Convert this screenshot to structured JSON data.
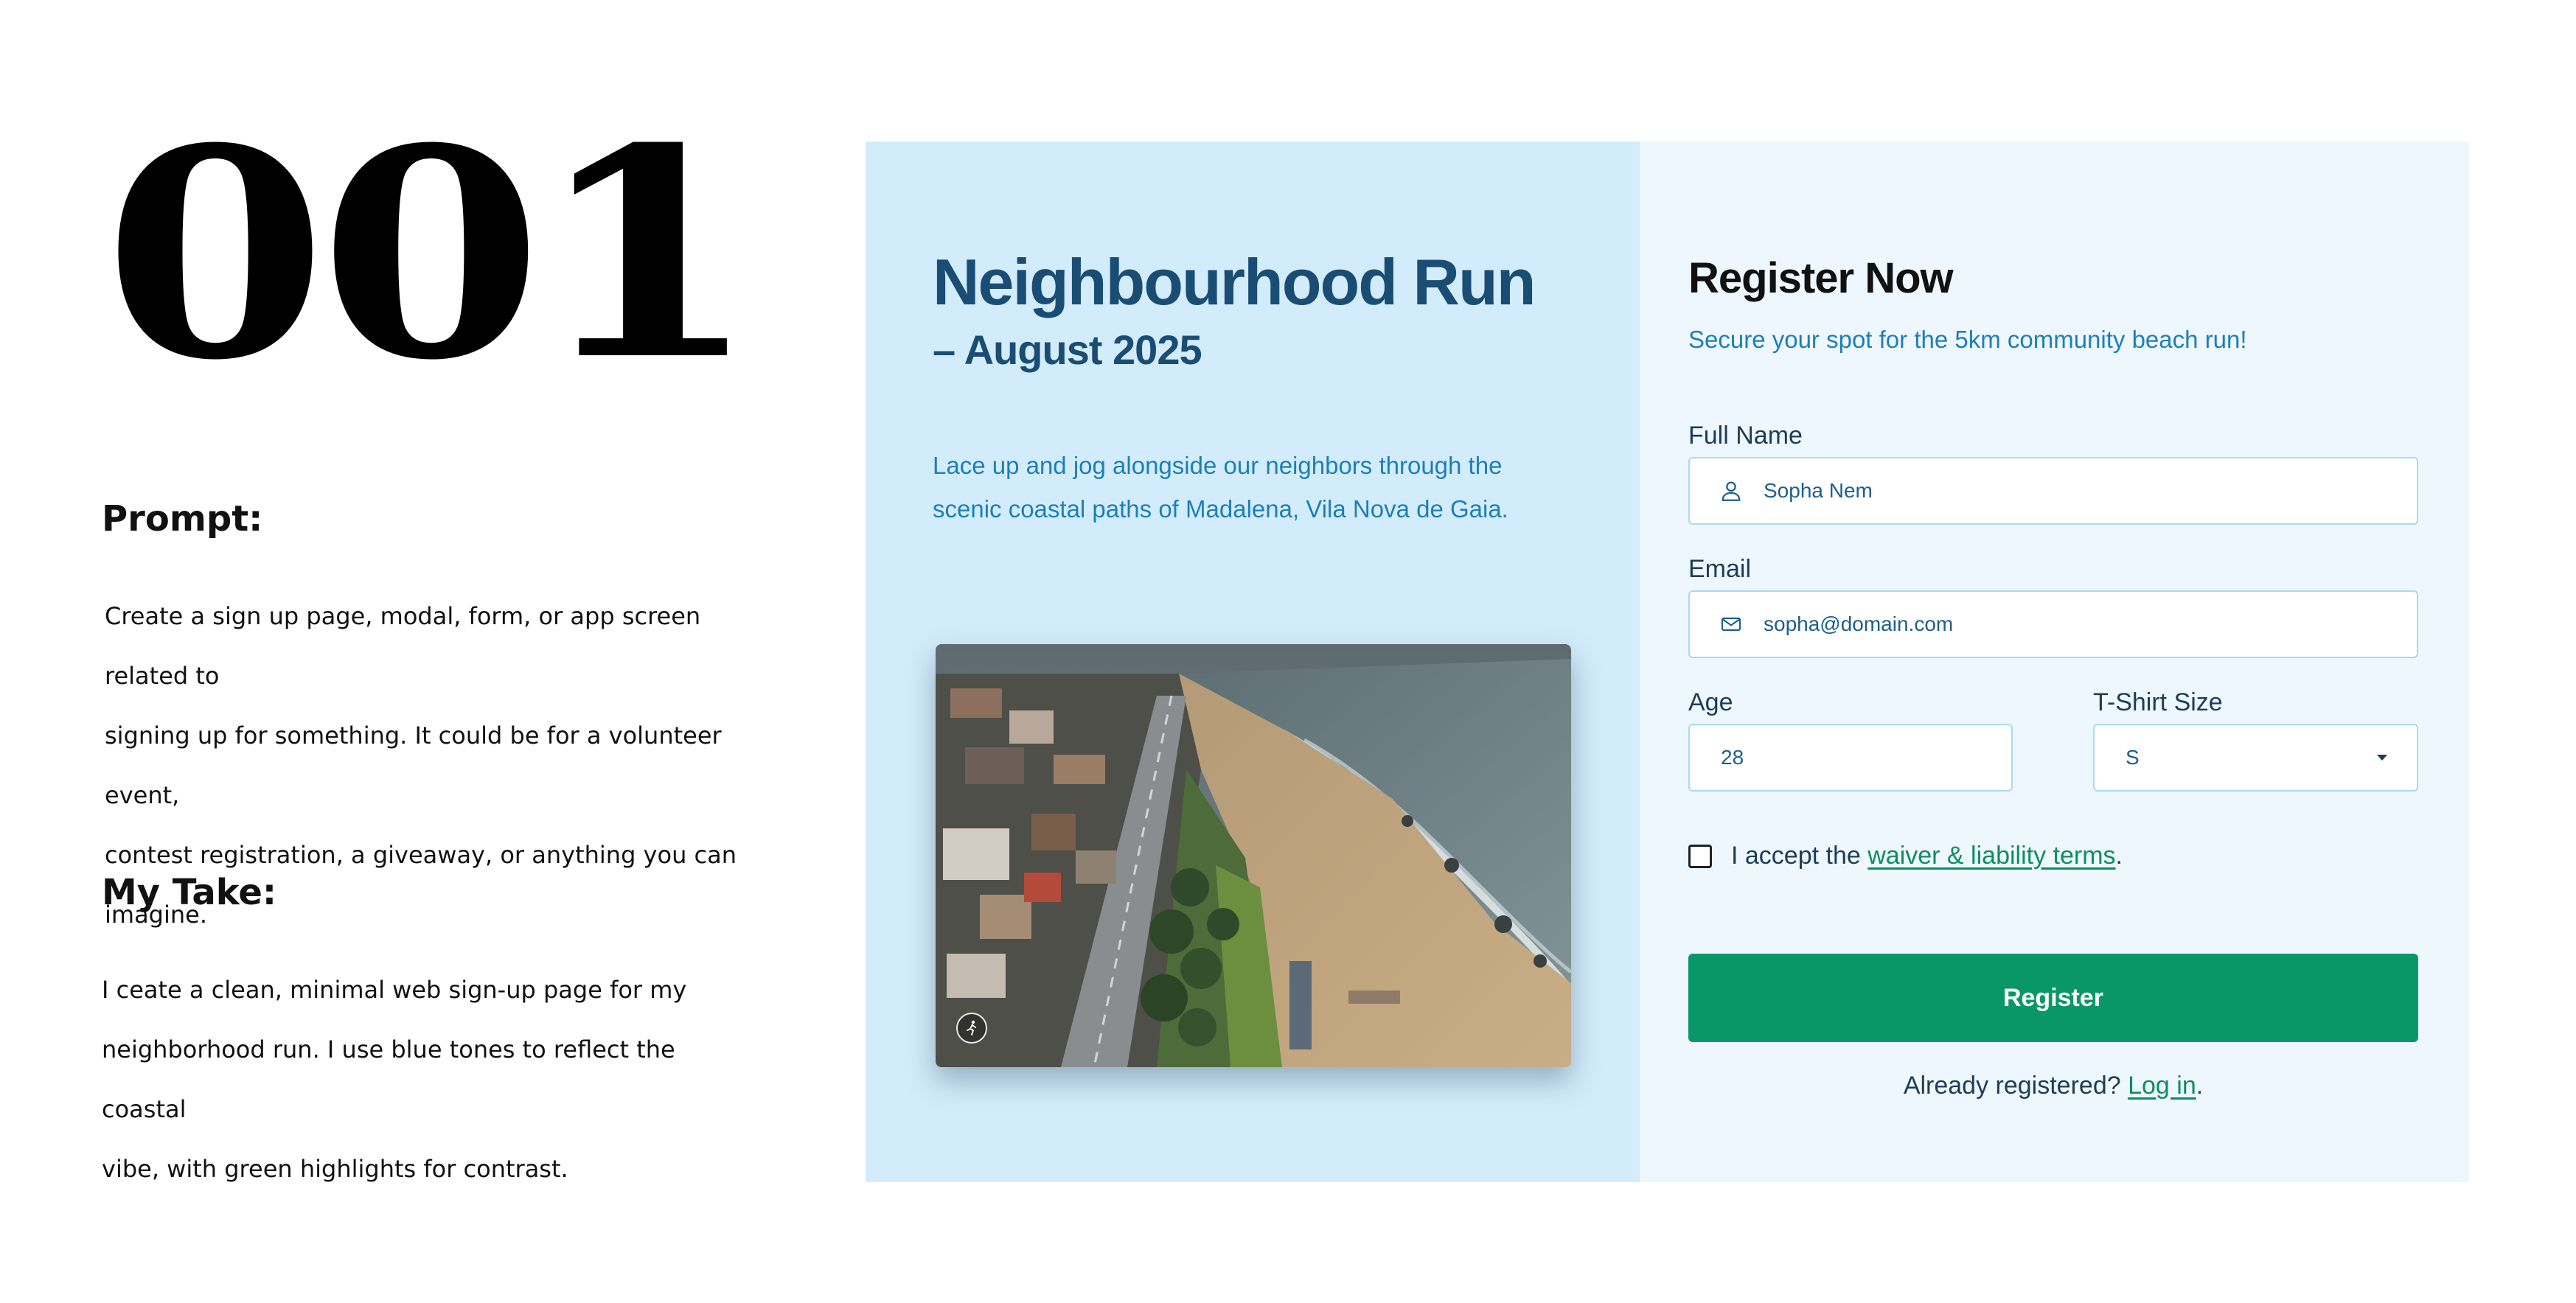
{
  "showcase": {
    "number": "001",
    "prompt_heading": "Prompt:",
    "prompt_lines": [
      "Create a sign up page, modal, form, or app screen related to",
      "signing up for something. It could be for a volunteer event,",
      "contest registration, a giveaway, or anything you can imagine."
    ],
    "take_heading": "My Take:",
    "take_lines": [
      "I ceate a clean, minimal web sign-up page for my",
      "neighborhood run. I use blue tones to reflect the coastal",
      "vibe, with green highlights for contrast."
    ]
  },
  "hero": {
    "title": "Neighbourhood Run",
    "date": "– August 2025",
    "description_lines": [
      "Lace up and jog alongside our neighbors through the",
      "scenic coastal paths of Madalena, Vila Nova de Gaia."
    ],
    "photo_badge_icon": "runner-icon"
  },
  "form": {
    "title": "Register Now",
    "subtitle": "Secure your spot for the 5km community beach run!",
    "full_name": {
      "label": "Full Name",
      "value": "Sopha Nem",
      "icon": "user-icon"
    },
    "email": {
      "label": "Email",
      "value": "sopha@domain.com",
      "icon": "mail-icon"
    },
    "age": {
      "label": "Age",
      "value": "28"
    },
    "tshirt": {
      "label": "T-Shirt Size",
      "value": "S",
      "icon": "caret-down-icon"
    },
    "terms": {
      "prefix": "I accept the",
      "link": "waiver & liability terms",
      "suffix": ".",
      "checked": false
    },
    "submit_label": "Register",
    "login": {
      "prefix": "Already registered?",
      "link": "Log in",
      "suffix": "."
    }
  },
  "colors": {
    "hero_bg": "#d3ecfb",
    "form_bg": "#eef7fd",
    "title_blue": "#1a4d74",
    "accent_blue": "#1d7fb8",
    "accent_green": "#0a9768"
  }
}
